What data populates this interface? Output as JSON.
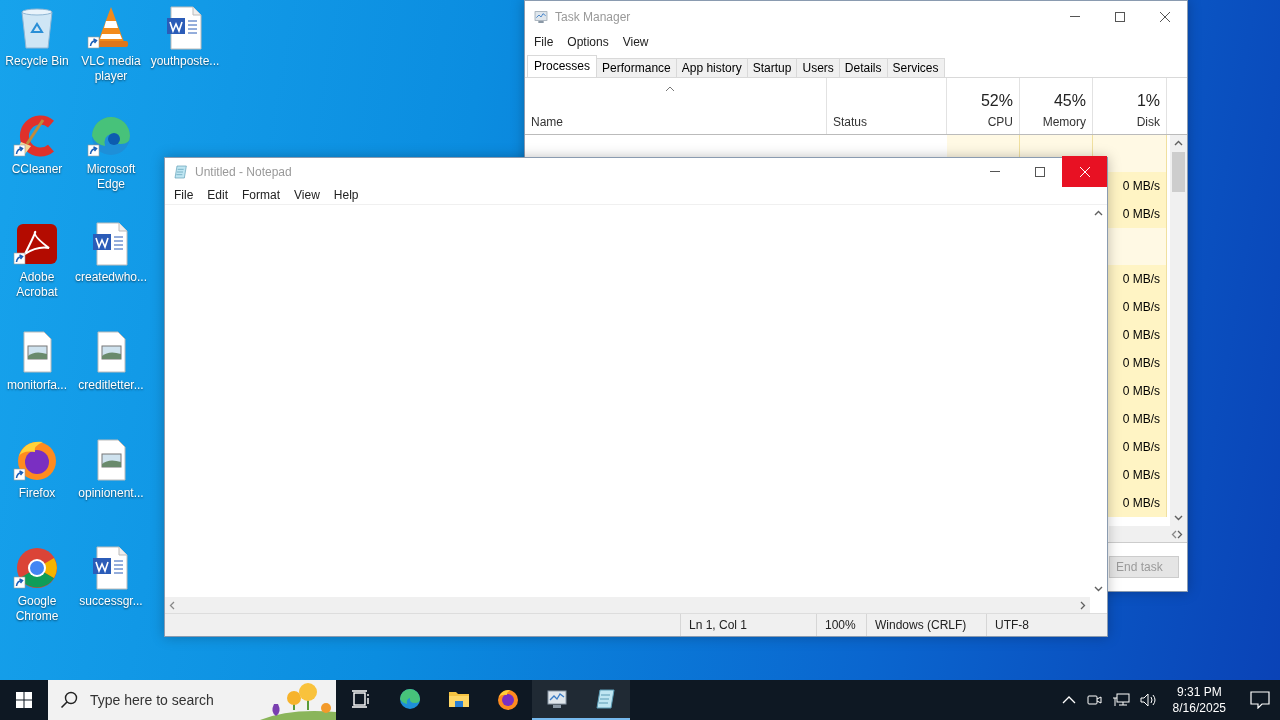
{
  "desktop_icons": [
    {
      "label": "Recycle Bin",
      "kind": "recycle",
      "shortcut": false
    },
    {
      "label": "CCleaner",
      "kind": "ccleaner",
      "shortcut": true
    },
    {
      "label": "Adobe Acrobat",
      "kind": "acrobat",
      "shortcut": true
    },
    {
      "label": "monitorfa...",
      "kind": "image-file",
      "shortcut": false
    },
    {
      "label": "Firefox",
      "kind": "firefox",
      "shortcut": true
    },
    {
      "label": "Google Chrome",
      "kind": "chrome",
      "shortcut": true
    },
    {
      "label": "VLC media player",
      "kind": "vlc",
      "shortcut": true
    },
    {
      "label": "Microsoft Edge",
      "kind": "edge",
      "shortcut": true
    },
    {
      "label": "createdwho...",
      "kind": "word-file",
      "shortcut": false
    },
    {
      "label": "creditletter...",
      "kind": "image-file",
      "shortcut": false
    },
    {
      "label": "opinionent...",
      "kind": "image-file",
      "shortcut": false
    },
    {
      "label": "successgr...",
      "kind": "word-file",
      "shortcut": false
    },
    {
      "label": "youthposte...",
      "kind": "word-file",
      "shortcut": false
    }
  ],
  "task_manager": {
    "title": "Task Manager",
    "menu": [
      "File",
      "Options",
      "View"
    ],
    "tabs": [
      {
        "label": "Processes",
        "selected": true
      },
      {
        "label": "Performance",
        "selected": false
      },
      {
        "label": "App history",
        "selected": false
      },
      {
        "label": "Startup",
        "selected": false
      },
      {
        "label": "Users",
        "selected": false
      },
      {
        "label": "Details",
        "selected": false
      },
      {
        "label": "Services",
        "selected": false
      }
    ],
    "columns": [
      {
        "name": "Name"
      },
      {
        "name": "Status"
      },
      {
        "percent": "52%",
        "name": "CPU"
      },
      {
        "percent": "45%",
        "name": "Memory"
      },
      {
        "percent": "1%",
        "name": "Disk"
      }
    ],
    "groups": [
      {
        "rows": [
          {
            "disk": "0 MB/s"
          },
          {
            "disk": "0 MB/s"
          }
        ]
      },
      {
        "rows": [
          {
            "disk": "0 MB/s"
          },
          {
            "disk": "0 MB/s"
          },
          {
            "disk": "0 MB/s"
          },
          {
            "disk": "0 MB/s"
          },
          {
            "disk": "0 MB/s"
          },
          {
            "disk": "0 MB/s"
          },
          {
            "disk": "0 MB/s"
          },
          {
            "disk": "0 MB/s"
          },
          {
            "disk": "0 MB/s"
          }
        ]
      }
    ],
    "end_task": {
      "label": "End task",
      "disabled": true
    }
  },
  "notepad": {
    "title": "Untitled - Notepad",
    "menu": [
      "File",
      "Edit",
      "Format",
      "View",
      "Help"
    ],
    "status_bar": [
      "Ln 1, Col 1",
      "100%",
      "Windows (CRLF)",
      "UTF-8"
    ]
  },
  "taskbar": {
    "search": {
      "placeholder": "Type here to search"
    },
    "apps": [
      {
        "kind": "task-view",
        "active": false
      },
      {
        "kind": "edge",
        "active": false
      },
      {
        "kind": "explorer",
        "active": false
      },
      {
        "kind": "firefox",
        "active": false
      },
      {
        "kind": "taskmgr",
        "active": true
      },
      {
        "kind": "notepad",
        "active": true
      }
    ],
    "clock": {
      "time": "9:31 PM",
      "date": "8/16/2025"
    }
  }
}
